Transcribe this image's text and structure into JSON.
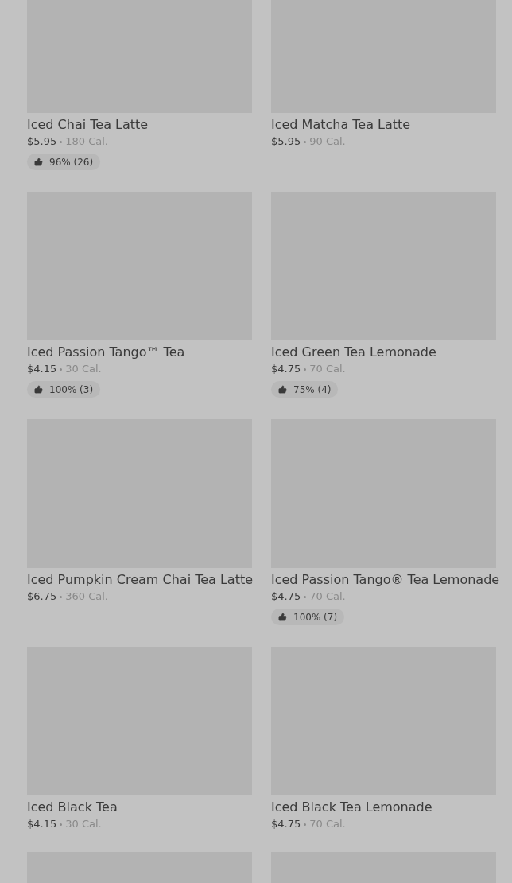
{
  "items": [
    {
      "kind": "product",
      "name": "Iced Chai Tea Latte",
      "price": "$5.95",
      "calories": "180 Cal.",
      "rating": "96% (26)"
    },
    {
      "kind": "product",
      "name": "Iced Matcha Tea Latte",
      "price": "$5.95",
      "calories": "90 Cal."
    },
    {
      "kind": "product",
      "name": "Iced Passion Tango™ Tea",
      "price": "$4.15",
      "calories": "30 Cal.",
      "rating": "100% (3)"
    },
    {
      "kind": "product",
      "name": "Iced Green Tea Lemonade",
      "price": "$4.75",
      "calories": "70 Cal.",
      "rating": "75% (4)"
    },
    {
      "kind": "product",
      "name": "Iced Pumpkin Cream Chai Tea Latte",
      "price": "$6.75",
      "calories": "360 Cal."
    },
    {
      "kind": "product",
      "name": "Iced Passion Tango® Tea Lemonade",
      "price": "$4.75",
      "calories": "70 Cal.",
      "rating": "100% (7)"
    },
    {
      "kind": "product",
      "name": "Iced Black Tea",
      "price": "$4.15",
      "calories": "30 Cal."
    },
    {
      "kind": "product",
      "name": "Iced Black Tea Lemonade",
      "price": "$4.75",
      "calories": "70 Cal."
    },
    {
      "kind": "image_only"
    },
    {
      "kind": "image_only"
    }
  ]
}
